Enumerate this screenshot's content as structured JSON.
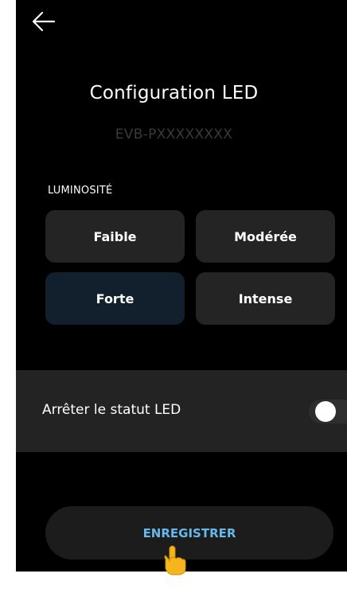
{
  "header": {
    "back_icon": "arrow-left-icon",
    "title": "Configuration LED",
    "device_id": "EVB-PXXXXXXXX"
  },
  "brightness": {
    "label": "LUMINOSITÉ",
    "options": [
      "Faible",
      "Modérée",
      "Forte",
      "Intense"
    ],
    "selected": "Forte"
  },
  "led_status": {
    "label": "Arrêter le statut LED",
    "enabled": false
  },
  "actions": {
    "save_label": "ENREGISTRER",
    "pointer_icon": "hand-pointer-icon"
  },
  "colors": {
    "background": "#000000",
    "button": "#242424",
    "selected_button": "#11202c",
    "accent": "#66b8ea"
  }
}
